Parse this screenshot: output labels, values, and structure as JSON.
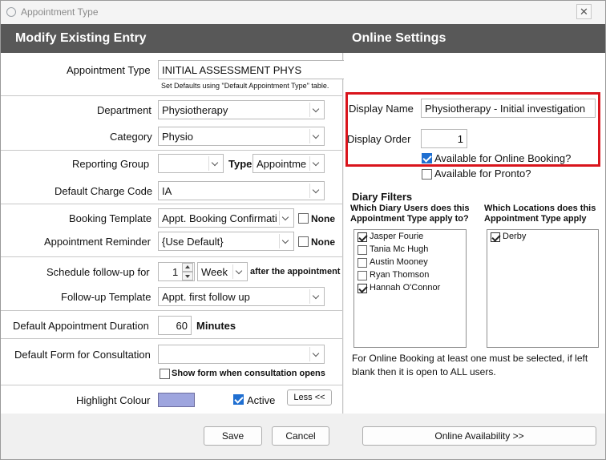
{
  "window": {
    "title": "Appointment Type",
    "close_glyph": "✕"
  },
  "header": {
    "left_title": "Modify Existing Entry",
    "right_title": "Online Settings"
  },
  "form": {
    "appointment_type": {
      "label": "Appointment Type",
      "value": "INITIAL ASSESSMENT PHYS",
      "hint": "Set Defaults using \"Default Appointment Type\" table."
    },
    "department": {
      "label": "Department",
      "value": "Physiotherapy"
    },
    "category": {
      "label": "Category",
      "value": "Physio"
    },
    "reporting_group": {
      "label": "Reporting Group",
      "value": "",
      "type_label": "Type",
      "type_value": "Appointme"
    },
    "default_charge_code": {
      "label": "Default Charge Code",
      "value": "IA"
    },
    "booking_template": {
      "label": "Booking Template",
      "value": "Appt. Booking Confirmati",
      "none_label": "None",
      "none_checked": false
    },
    "appointment_reminder": {
      "label": "Appointment Reminder",
      "value": "{Use Default}",
      "none_label": "None",
      "none_checked": false
    },
    "schedule_followup": {
      "label": "Schedule follow-up for",
      "count": "1",
      "unit": "Week",
      "suffix": "after the appointment"
    },
    "followup_template": {
      "label": "Follow-up Template",
      "value": "Appt. first follow up"
    },
    "default_duration": {
      "label": "Default Appointment Duration",
      "value": "60",
      "unit": "Minutes"
    },
    "default_form": {
      "label": "Default Form for Consultation",
      "value": "",
      "show_form_label": "Show form when consultation opens",
      "show_form_checked": false
    },
    "highlight_colour": {
      "label": "Highlight Colour",
      "color": "#9ea5de",
      "active_label": "Active",
      "active_checked": true,
      "less_button": "Less <<"
    }
  },
  "online": {
    "display_name": {
      "label": "Display Name",
      "value": "Physiotherapy - Initial investigation"
    },
    "display_order": {
      "label": "Display Order",
      "value": "1"
    },
    "available_online": {
      "label": "Available for Online Booking?",
      "checked": true
    },
    "available_pronto": {
      "label": "Available for Pronto?",
      "checked": false
    },
    "diary_filters": {
      "title": "Diary Filters",
      "users_heading": "Which Diary Users does this Appointment Type apply to?",
      "locations_heading": "Which Locations does this Appointment Type apply",
      "users": [
        {
          "name": "Jasper Fourie",
          "checked": true
        },
        {
          "name": "Tania Mc Hugh",
          "checked": false
        },
        {
          "name": "Austin Mooney",
          "checked": false
        },
        {
          "name": "Ryan Thomson",
          "checked": false
        },
        {
          "name": "Hannah O'Connor",
          "checked": true
        }
      ],
      "locations": [
        {
          "name": "Derby",
          "checked": true
        }
      ],
      "note": "For Online Booking at least one must be selected, if left blank then it is open to ALL users."
    }
  },
  "footer": {
    "save": "Save",
    "cancel": "Cancel",
    "online_availability": "Online Availability >>"
  },
  "colors": {
    "header_bg": "#585858",
    "highlight": "#d9141c",
    "check_accent": "#1f6fd1"
  }
}
